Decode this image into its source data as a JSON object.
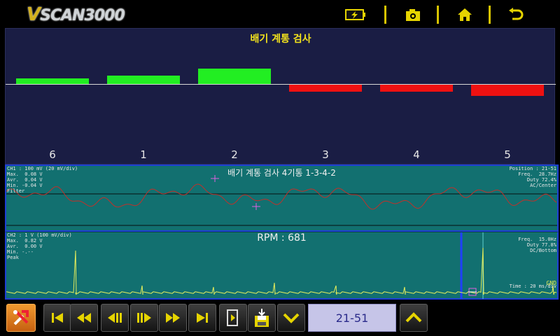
{
  "header": {
    "logo_text": "SCAN3000",
    "logo_v": "V",
    "icons": [
      "battery-charging-icon",
      "camera-icon",
      "home-icon",
      "back-icon"
    ]
  },
  "colors": {
    "accent_yellow": "#f2e21c",
    "bar_positive": "#22ee22",
    "bar_negative": "#ee1111",
    "scope_bg": "#127070",
    "wave1": "#c0302a",
    "wave2": "#e8ef5a"
  },
  "balance": {
    "title": "배기 계통 검사",
    "cylinders": [
      {
        "label": "6",
        "value": 8
      },
      {
        "label": "1",
        "value": 12
      },
      {
        "label": "2",
        "value": 22
      },
      {
        "label": "3",
        "value": -10
      },
      {
        "label": "4",
        "value": -10
      },
      {
        "label": "5",
        "value": -16
      }
    ]
  },
  "ch1": {
    "title": "배기 계통 검사 4기통 1-3-4-2",
    "left_info": "CH1 : 100 mV (20 mV/div)\nMax.  0.08 V\nAvr.  0.04 V\nMin. -0.04 V\nFilter",
    "right_info": "Position : 21-51\nFreq.  28.7Hz\nDuty 72.4%\nAC/Center"
  },
  "ch2": {
    "title": "RPM : 681",
    "left_info": "CH2 : 1 V (100 mV/div)\nMax.  0.82 V\nAvr.  0.00 V\nMin. -.--\nPeak",
    "right_info": "Freq.  15.0Hz\nDuty 77.8%\nDC/Bottom",
    "time": "Time : 20 ms/div",
    "gnd": "GND"
  },
  "bottombar": {
    "position": "21-51"
  }
}
